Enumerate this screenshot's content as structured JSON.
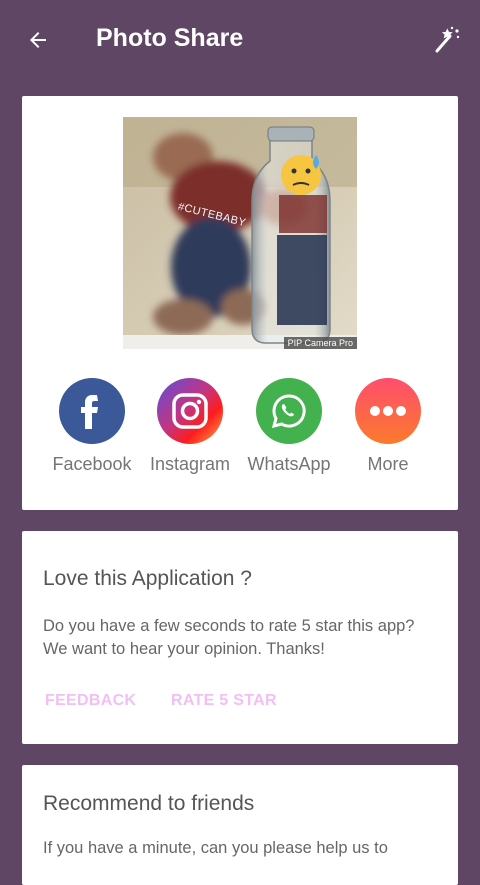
{
  "header": {
    "title": "Photo Share",
    "back_icon": "arrow-back-icon",
    "wand_icon": "magic-wand-icon"
  },
  "photo": {
    "hashtag": "#CUTEBABY",
    "watermark": "PIP Camera Pro"
  },
  "share": {
    "items": [
      {
        "label": "Facebook",
        "icon": "facebook-icon",
        "color": "#3b5998"
      },
      {
        "label": "Instagram",
        "icon": "instagram-icon",
        "color": "#c13584"
      },
      {
        "label": "WhatsApp",
        "icon": "whatsapp-icon",
        "color": "#43b14e"
      },
      {
        "label": "More",
        "icon": "more-icon",
        "color": "#fb5c3a"
      }
    ]
  },
  "rate_card": {
    "title": "Love this Application ?",
    "body": "Do you have a few seconds to rate 5 star this app? We want to hear your opinion. Thanks!",
    "feedback_label": "FEEDBACK",
    "rate_label": "RATE 5 STAR"
  },
  "recommend_card": {
    "title": "Recommend to friends",
    "body": "If you have a minute, can you please help us to"
  },
  "colors": {
    "background": "#5e4664",
    "card": "#ffffff",
    "accent_text": "#f2bff2"
  }
}
